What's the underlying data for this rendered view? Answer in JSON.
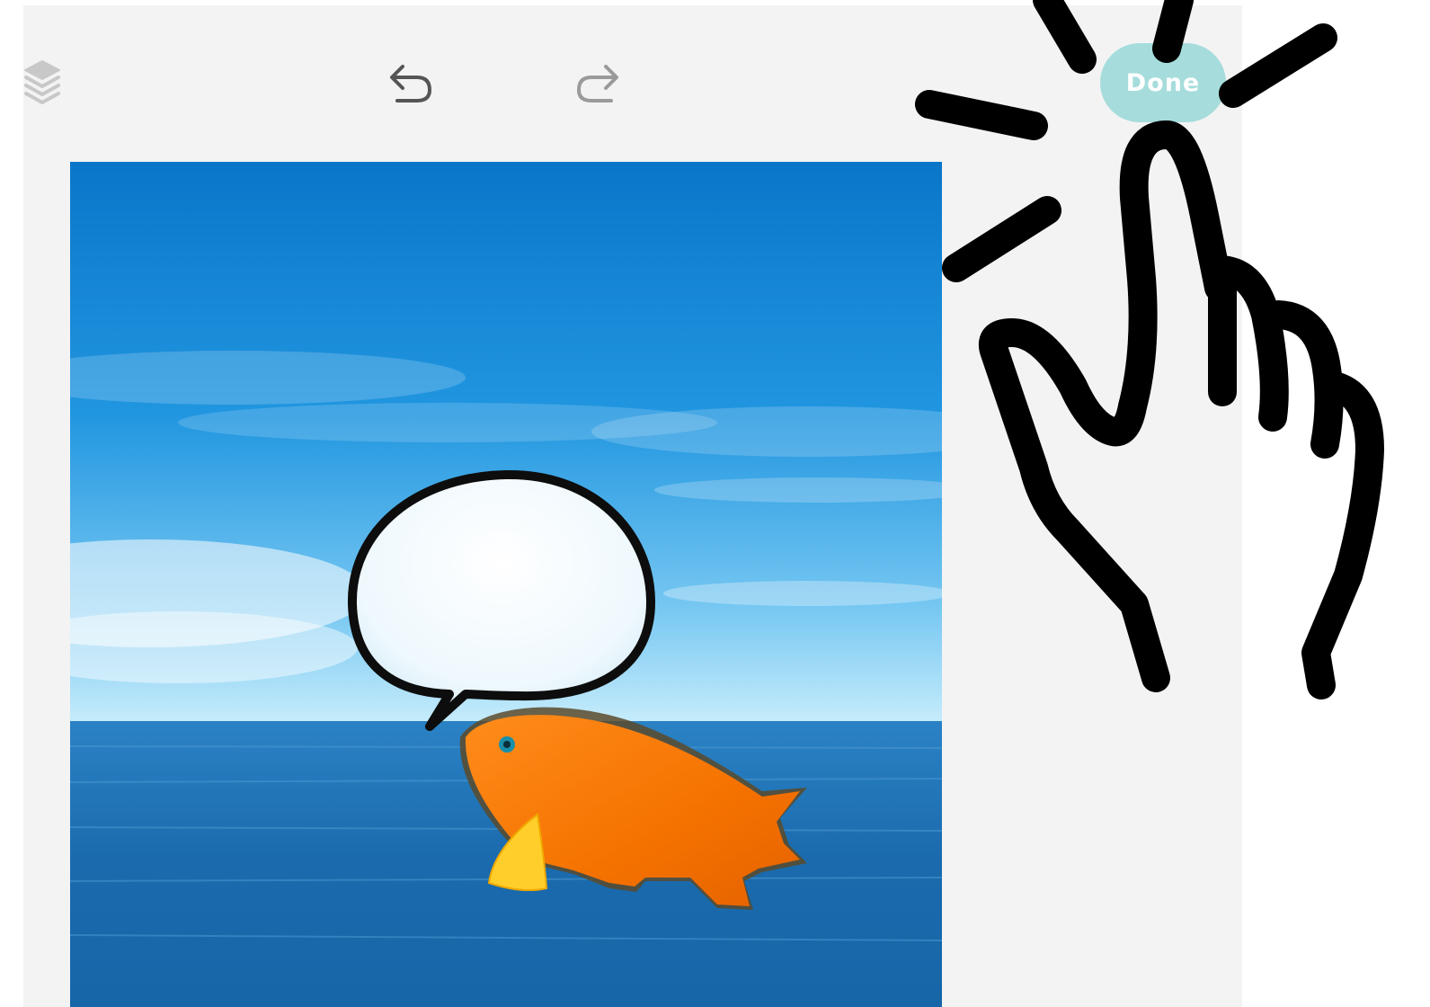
{
  "toolbar": {
    "layers_icon": "layers-icon",
    "undo_icon": "undo-arrow-icon",
    "redo_icon": "redo-arrow-icon",
    "done_label": "Done",
    "done_color": "#a6dcdc"
  },
  "canvas": {
    "background_scene": "sky-and-ocean-photo",
    "stickers": [
      {
        "kind": "speech-bubble",
        "text": ""
      },
      {
        "kind": "orange-fish"
      }
    ]
  },
  "overlay": {
    "gesture_icon": "tap-hand-icon"
  }
}
